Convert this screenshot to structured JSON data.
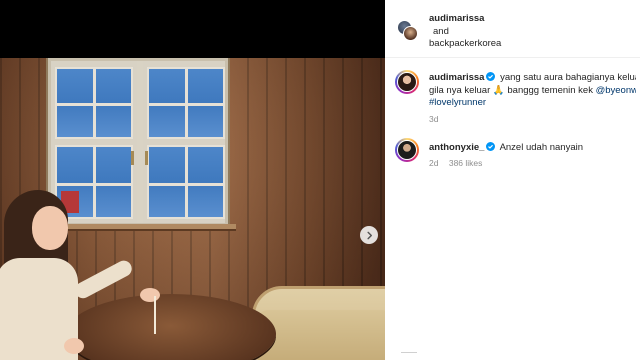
{
  "post": {
    "owner": "audimarissa",
    "and_text": "and",
    "collaborator": "backpackerkorea"
  },
  "caption": {
    "user": "audimarissa",
    "line1": "yang satu aura bahagianya keluar",
    "line2_text": "gila nya keluar",
    "line2_emoji": "🙏",
    "line2_more": "banggg temenin kek",
    "mention": "@byeonw",
    "hashtag": "#lovelyrunner",
    "time": "3d"
  },
  "comments": [
    {
      "user": "anthonyxie_",
      "text": "Anzel udah nanyain",
      "time": "2d",
      "likes": "386 likes"
    }
  ],
  "colors": {
    "verified": "#0095f6",
    "link": "#00376b",
    "muted": "#8e8e8e"
  },
  "icons": {
    "carousel_next": "chevron-right-icon",
    "verified": "verified-badge-icon"
  }
}
